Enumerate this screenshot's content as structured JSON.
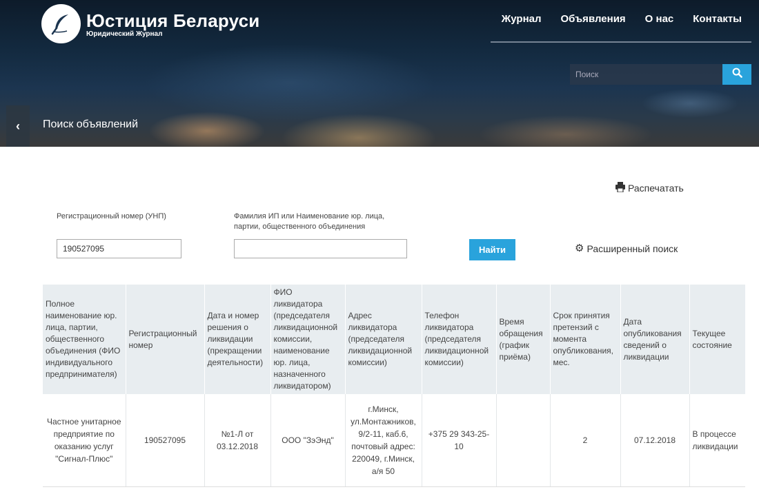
{
  "header": {
    "title": "Юстиция Беларуси",
    "subtitle": "Юридический Журнал",
    "nav": [
      "Журнал",
      "Объявления",
      "О нас",
      "Контакты"
    ],
    "search_placeholder": "Поиск"
  },
  "page": {
    "title": "Поиск объявлений",
    "print_label": "Распечатать"
  },
  "form": {
    "unp_label": "Регистрационный номер (УНП)",
    "unp_value": "190527095",
    "name_label": "Фамилия ИП или Наименование юр. лица, партии, общественного объединения",
    "name_value": "",
    "find_label": "Найти",
    "advanced_label": "Расширенный поиск"
  },
  "table": {
    "headers": [
      "Полное наименование юр. лица, партии, общественного объединения (ФИО индивидуального предпринимателя)",
      "Регистрационный номер",
      "Дата и номер решения о ликвидации (прекращении деятельности)",
      "ФИО ликвидатора (председателя ликвидационной комиссии, наименование юр. лица, назначенного ликвидатором)",
      "Адрес ликвидатора (председателя ликвидационной комиссии)",
      "Телефон ликвидатора (председателя ликвидационной комиссии)",
      "Время обращения (график приёма)",
      "Срок принятия претензий с момента опубликования, мес.",
      "Дата опубликования сведений о ликвидации",
      "Текущее состояние"
    ],
    "rows": [
      [
        "Частное унитарное предприятие по оказанию услуг \"Сигнал-Плюс\"",
        "190527095",
        "№1-Л от 03.12.2018",
        "ООО \"ЗэЭнд\"",
        "г.Минск, ул.Монтажников, 9/2-11, каб.6, почтовый адрес: 220049, г.Минск, а/я 50",
        "+375 29 343-25-10",
        "",
        "2",
        "07.12.2018",
        "В процессе ликвидации"
      ]
    ]
  },
  "icons": {
    "logo": "quill-feather-icon",
    "search": "search-icon",
    "back": "chevron-left-icon",
    "print": "printer-icon",
    "advanced": "gear-icon"
  },
  "colors": {
    "accent": "#29a3dc",
    "header_bg": "#132a40",
    "table_header_bg": "#e8edf0"
  }
}
